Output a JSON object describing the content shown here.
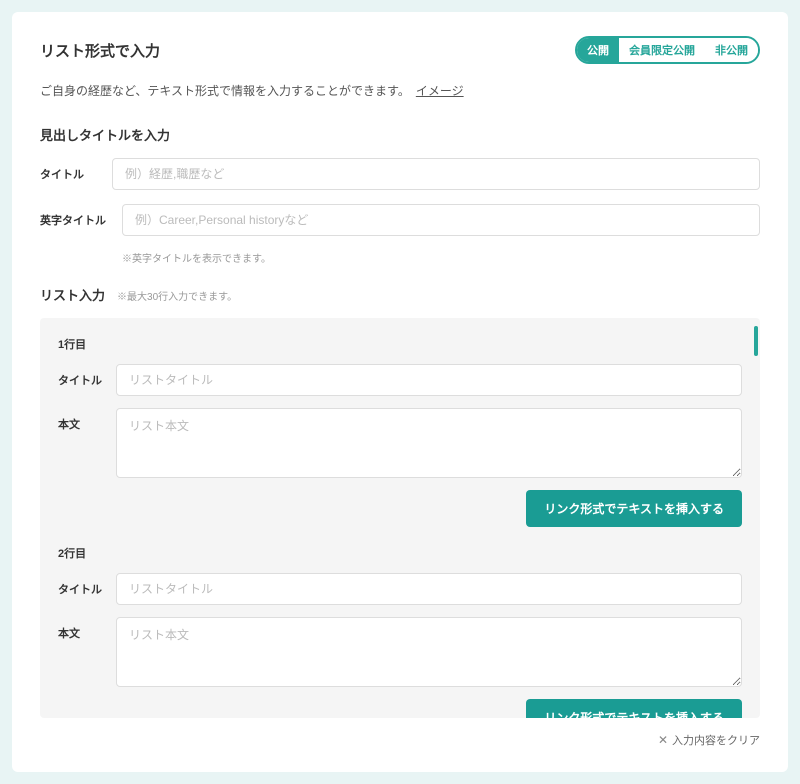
{
  "header": {
    "title": "リスト形式で入力",
    "visibility": {
      "options": [
        "公開",
        "会員限定公開",
        "非公開"
      ],
      "active_index": 0
    }
  },
  "description": {
    "text": "ご自身の経歴など、テキスト形式で情報を入力することができます。　",
    "image_link": "イメージ"
  },
  "heading_section": {
    "title": "見出しタイトルを入力",
    "title_field": {
      "label": "タイトル",
      "placeholder": "例）経歴,職歴など"
    },
    "en_title_field": {
      "label": "英字タイトル",
      "placeholder": "例）Career,Personal historyなど",
      "hint": "※英字タイトルを表示できます。"
    }
  },
  "list_section": {
    "title": "リスト入力",
    "hint": "※最大30行入力できます。",
    "rows": [
      {
        "number": "1行目",
        "title_label": "タイトル",
        "title_placeholder": "リストタイトル",
        "body_label": "本文",
        "body_placeholder": "リスト本文",
        "insert_button": "リンク形式でテキストを挿入する"
      },
      {
        "number": "2行目",
        "title_label": "タイトル",
        "title_placeholder": "リストタイトル",
        "body_label": "本文",
        "body_placeholder": "リスト本文",
        "insert_button": "リンク形式でテキストを挿入する"
      }
    ]
  },
  "footer": {
    "clear_label": "入力内容をクリア"
  }
}
